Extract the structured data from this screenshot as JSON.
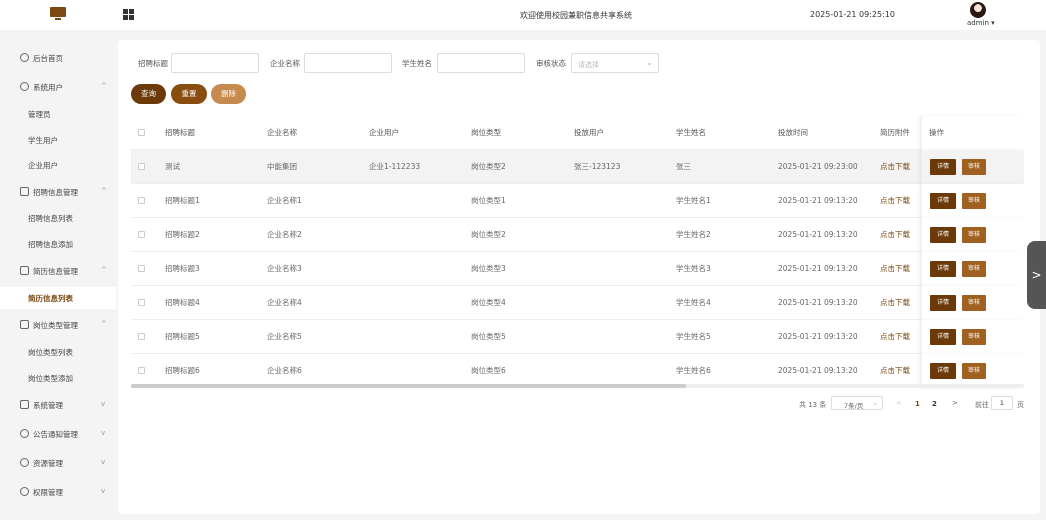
{
  "topbar": {
    "title": "欢迎使用校园兼职信息共享系统",
    "datetime": "2025-01-21 09:25:10",
    "username": "admin ▾"
  },
  "sidebar": {
    "items": [
      {
        "label": "后台首页",
        "icon": "home-icon",
        "arrow": ""
      },
      {
        "label": "系统用户",
        "icon": "user-icon",
        "arrow": "^"
      },
      {
        "label": "管理员"
      },
      {
        "label": "学生用户"
      },
      {
        "label": "企业用户"
      },
      {
        "label": "招聘信息管理",
        "icon": "list-icon",
        "arrow": "^"
      },
      {
        "label": "招聘信息列表"
      },
      {
        "label": "招聘信息添加"
      },
      {
        "label": "简历信息管理",
        "icon": "resume-icon",
        "arrow": "^"
      },
      {
        "label": "简历信息列表"
      },
      {
        "label": "岗位类型管理",
        "icon": "tag-icon",
        "arrow": "^"
      },
      {
        "label": "岗位类型列表"
      },
      {
        "label": "岗位类型添加"
      },
      {
        "label": "系统管理",
        "icon": "folder-icon",
        "arrow": "v"
      },
      {
        "label": "公告通知管理",
        "icon": "bell-icon",
        "arrow": "v"
      },
      {
        "label": "资源管理",
        "icon": "resource-icon",
        "arrow": "v"
      },
      {
        "label": "权限管理",
        "icon": "permission-icon",
        "arrow": "v"
      }
    ]
  },
  "filters": {
    "title_label": "招聘标题",
    "company_label": "企业名称",
    "student_label": "学生姓名",
    "status_label": "审核状态",
    "status_placeholder": "请选择",
    "buttons": {
      "query": "查询",
      "reset": "重置",
      "delete": "删除"
    }
  },
  "table": {
    "headers": [
      "招聘标题",
      "企业名称",
      "企业用户",
      "岗位类型",
      "投放用户",
      "学生姓名",
      "投放时间",
      "简历附件",
      "操作"
    ],
    "rows": [
      [
        "测试",
        "中能集团",
        "企业1-112233",
        "岗位类型2",
        "张三-123123",
        "张三",
        "2025-01-21 09:23:00",
        "点击下载"
      ],
      [
        "招聘标题1",
        "企业名称1",
        "",
        "岗位类型1",
        "",
        "学生姓名1",
        "2025-01-21 09:13:20",
        "点击下载"
      ],
      [
        "招聘标题2",
        "企业名称2",
        "",
        "岗位类型2",
        "",
        "学生姓名2",
        "2025-01-21 09:13:20",
        "点击下载"
      ],
      [
        "招聘标题3",
        "企业名称3",
        "",
        "岗位类型3",
        "",
        "学生姓名3",
        "2025-01-21 09:13:20",
        "点击下载"
      ],
      [
        "招聘标题4",
        "企业名称4",
        "",
        "岗位类型4",
        "",
        "学生姓名4",
        "2025-01-21 09:13:20",
        "点击下载"
      ],
      [
        "招聘标题5",
        "企业名称5",
        "",
        "岗位类型5",
        "",
        "学生姓名5",
        "2025-01-21 09:13:20",
        "点击下载"
      ],
      [
        "招聘标题6",
        "企业名称6",
        "",
        "岗位类型6",
        "",
        "学生姓名6",
        "2025-01-21 09:13:20",
        "点击下载"
      ]
    ],
    "actions": {
      "detail": "详情",
      "audit": "审核"
    }
  },
  "pagination": {
    "total": "共 13 条",
    "page_size": "7条/页",
    "prev": "<",
    "pages": [
      "1",
      "2"
    ],
    "next": ">",
    "goto_label": "前往",
    "goto_value": "1",
    "page_suffix": "页"
  },
  "side_tab": {
    "label": ">"
  },
  "colors": {
    "brand": "#7a4a12",
    "primary_button": "#6b3a08",
    "secondary_button": "#8a4d10",
    "delete_button": "#c48a4e"
  }
}
